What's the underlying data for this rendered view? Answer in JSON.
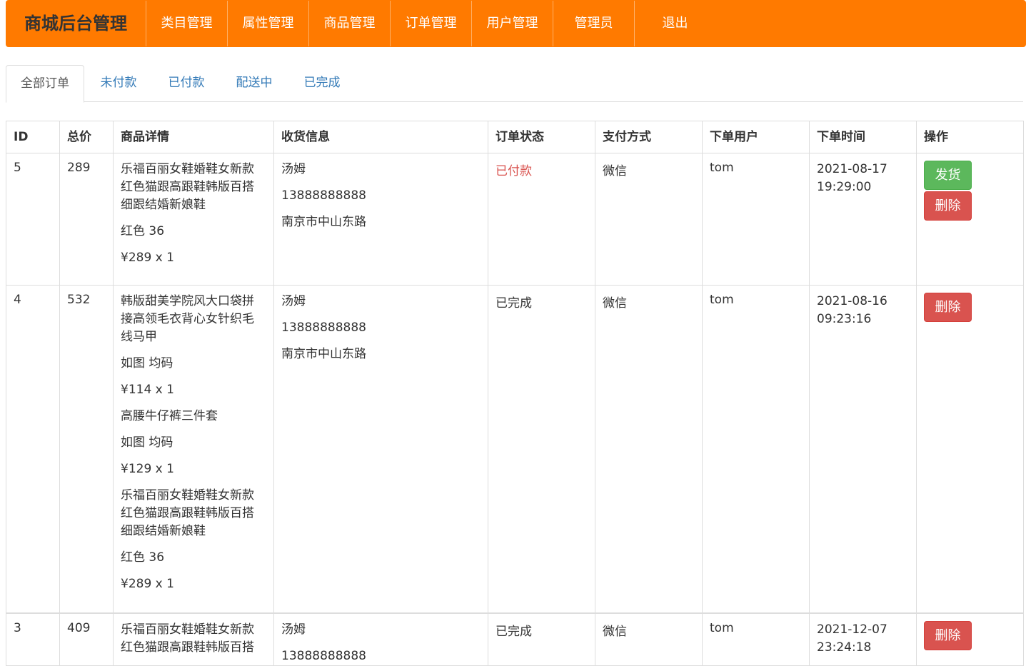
{
  "nav": {
    "brand": "商城后台管理",
    "items": [
      "类目管理",
      "属性管理",
      "商品管理",
      "订单管理",
      "用户管理",
      "管理员",
      "退出"
    ]
  },
  "tabs": [
    "全部订单",
    "未付款",
    "已付款",
    "配送中",
    "已完成"
  ],
  "table": {
    "headers": [
      "ID",
      "总价",
      "商品详情",
      "收货信息",
      "订单状态",
      "支付方式",
      "下单用户",
      "下单时间",
      "操作"
    ],
    "rows": [
      {
        "id": "5",
        "total": "289",
        "items": [
          {
            "name_l1": "乐福百丽女鞋婚鞋女新款",
            "name_l2": "红色猫跟高跟鞋韩版百搭",
            "name_l3": "细跟结婚新娘鞋",
            "spec": "红色 36",
            "price": "¥289 x 1"
          }
        ],
        "receiver": {
          "name": "汤姆",
          "phone": "13888888888",
          "address": "南京市中山东路"
        },
        "status": "已付款",
        "pay": "微信",
        "user": "tom",
        "date": "2021-08-17",
        "time": "19:29:00",
        "ship_label": "发货",
        "delete_label": "删除"
      },
      {
        "id": "4",
        "total": "532",
        "items": [
          {
            "name_l1": "韩版甜美学院风大口袋拼",
            "name_l2": "接高领毛衣背心女针织毛",
            "name_l3": "线马甲",
            "spec": "如图 均码",
            "price": "¥114 x 1"
          },
          {
            "name_l1": "高腰牛仔裤三件套",
            "spec": "如图 均码",
            "price": "¥129 x 1"
          },
          {
            "name_l1": "乐福百丽女鞋婚鞋女新款",
            "name_l2": "红色猫跟高跟鞋韩版百搭",
            "name_l3": "细跟结婚新娘鞋",
            "spec": "红色 36",
            "price": "¥289 x 1"
          }
        ],
        "receiver": {
          "name": "汤姆",
          "phone": "13888888888",
          "address": "南京市中山东路"
        },
        "status": "已完成",
        "pay": "微信",
        "user": "tom",
        "date": "2021-08-16",
        "time": "09:23:16",
        "delete_label": "删除"
      },
      {
        "id": "3",
        "total": "409",
        "items": [
          {
            "name_l1": "乐福百丽女鞋婚鞋女新款",
            "name_l2": "红色猫跟高跟鞋韩版百搭"
          }
        ],
        "receiver": {
          "name": "汤姆",
          "phone": "13888888888"
        },
        "status": "已完成",
        "pay": "微信",
        "user": "tom",
        "date": "2021-12-07",
        "time": "23:24:18",
        "delete_label": "删除"
      }
    ]
  },
  "colors": {
    "navbar": "#ff7a00",
    "success": "#5cb85c",
    "danger": "#d9534f",
    "link": "#337ab7"
  }
}
